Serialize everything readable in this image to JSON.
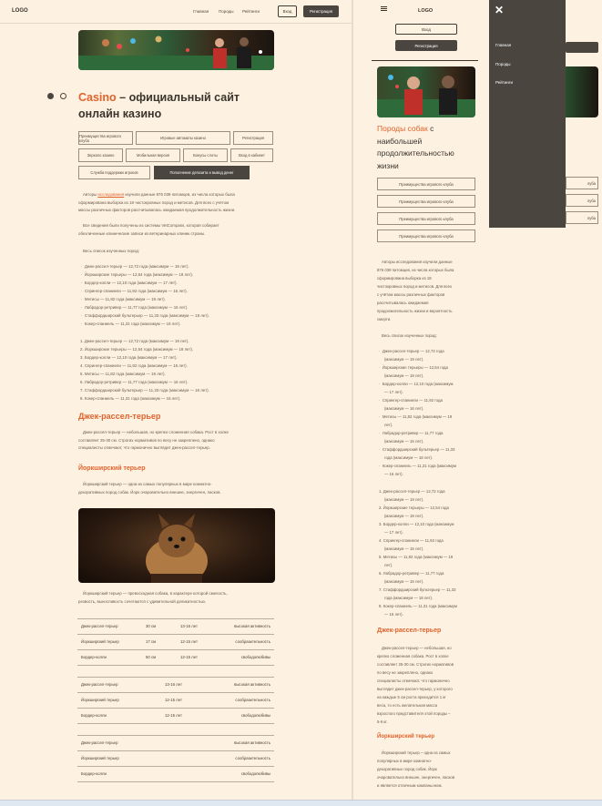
{
  "desktop": {
    "logo": "LOGO",
    "nav": [
      "Главная",
      "Породы",
      "Рейтинги"
    ],
    "login": "Вход",
    "register": "Регистрация",
    "title_highlight": "Casino",
    "title_rest_1": " – официальный сайт",
    "title_rest_2": "онлайн казино",
    "tags": [
      "Преимущества игрового клуба",
      "Игровые автоматы казино",
      "Регистрация",
      "Зеркало казино",
      "Мобильная версия",
      "Бонусы слоты",
      "Вход в кабинет",
      "Служба поддержки игроков",
      "Пополнение депозита и вывод денег"
    ],
    "intro_1a": "Авторы ",
    "intro_link": "исследования",
    "intro_1b": " изучили данные 876 039 питомцев, из числа которых была",
    "intro_2": "сформирована выборка из 18 чистокровных пород и метисов. Для всех с учётом",
    "intro_3": "массы различных факторов рассчитывалась ожидаемая продолжительность жизни.",
    "intro2_1": "Все сведения были получены из системы VetCompass, которая собирает",
    "intro2_2": "обезличенные клинические записи из ветеринарных клиник страны.",
    "list_heading": "Весь список изученных пород:",
    "bullets": [
      "Джек-рассел-терьер — 12,72 года (максимум — 19 лет).",
      "Йоркширские терьеры — 12,54 года (максимум — 18 лет).",
      "Бордер-колли — 12,10 года (максимум — 17 лет).",
      "Спрингер-спаниели — 11,92 года (максимум — 16 лет).",
      "Метисы — 11,82 года (максимум — 19 лет).",
      "Лабрадор-ретривер — 11,77 года (максимум — 16 лет).",
      "Стаффордширский бультерьер — 11,33 года (максимум — 18 лет).",
      "Кокер-спаниель — 11,31 года (максимум — 16 лет)."
    ],
    "numbered": [
      "1. Джек-рассел-терьер — 12,72 года (максимум — 19 лет).",
      "2. Йоркширские терьеры — 12,54 года (максимум — 18 лет).",
      "3. Бордер-колли — 12,10 года (максимум — 17 лет).",
      "4. Спрингер-спаниели — 11,92 года (максимум — 16 лет).",
      "5. Метисы — 11,82 года (максимум — 19 лет).",
      "6. Лабрадор-ретривер — 11,77 года (максимум — 16 лет).",
      "7. Стаффордширский бультерьер — 11,33 года (максимум — 18 лет).",
      "8. Кокер-спаниель — 11,31 года (максимум — 16 лет)."
    ],
    "h2_jack": "Джек-рассел-терьер",
    "jack_1": "Джек-рассел-терьер — небольшая, но крепко сложенная собака. Рост в холке",
    "jack_2": "составляет 25-30 см. Строгих нормативов по весу не закреплено, однако",
    "jack_3": "специалисты отмечают, что гармонично выглядит джек-рассел-терьер.",
    "h3_york": "Йоркширский терьер",
    "york_1": "Йоркширский терьер — одна из самых популярных в мире комнатно-",
    "york_2": "декоративных пород собак. Йорк очаровательно внешне, энергичен, ласков.",
    "york2_1": "Йоркширский терьер — превосходная собака, в характере которой смелость,",
    "york2_2": "резвость, выносливость сочетаются с удивительной деликатностью.",
    "table1": [
      [
        "Джек-рассел-терьер",
        "30 см",
        "13-16 лет",
        "высокая активность"
      ],
      [
        "Йоркширский терьер",
        "17 см",
        "12-15 лет",
        "сообразительность"
      ],
      [
        "Бордер-колли",
        "50 см",
        "12-15 лет",
        "свободолюбивы"
      ]
    ],
    "table2": [
      [
        "Джек-рассел-терьер",
        "13-16 лет",
        "высокая активность"
      ],
      [
        "Йоркширский терьер",
        "12-15 лет",
        "сообразительность"
      ],
      [
        "Бордер-колли",
        "12-15 лет",
        "свободолюбивы"
      ]
    ],
    "table3": [
      [
        "Джек-рассел-терьер",
        "высокая активность"
      ],
      [
        "Йоркширский терьер",
        "сообразительность"
      ],
      [
        "Бордер-колли",
        "свободолюбивы"
      ]
    ]
  },
  "mobile": {
    "logo": "LOGO",
    "login": "Вход",
    "register": "Регистрация",
    "title_1a": "Породы собак",
    "title_1b": " с",
    "title_2": "наибольшей",
    "title_3": "продолжительностью",
    "title_4": "жизни",
    "tags": [
      "Преимущества игрового клуба",
      "Преимущества игрового клуба",
      "Преимущества игрового клуба",
      "Преимущества игрового клуба"
    ],
    "intro": [
      "Авторы исследования изучили данные",
      "876 039 питомцев, из числа которых была",
      "сформирована выборка из 18",
      "чистокровных пород и метисов. Для всех",
      "с учётом массы различных факторов",
      "рассчитывалась ожидаемая",
      "продолжительность жизни и вероятность",
      "смерти."
    ],
    "list_heading": "Весь список изученных пород:",
    "bullets": [
      "Джек-рассел-терьер — 12,72 года",
      "(максимум — 19 лет).",
      "Йоркширские терьеры — 12,54 года",
      "(максимум — 18 лет).",
      "Бордер-колли — 12,10 года (максимум",
      "— 17 лет).",
      "Спрингер-спаниели — 11,92 года",
      "(максимум — 16 лет).",
      "Метисы — 11,82 года (максимум — 19",
      "лет).",
      "Лабрадор-ретривер — 11,77 года",
      "(максимум — 16 лет).",
      "Стаффордширский бультерьер — 11,33",
      "года (максимум — 18 лет).",
      "Кокер-спаниель — 11,31 года (максимум",
      "— 16 лет)."
    ],
    "numbered": [
      "1. Джек-рассел-терьер — 12,72 года",
      "(максимум — 19 лет).",
      "2. Йоркширские терьеры — 12,54 года",
      "(максимум — 18 лет).",
      "3. Бордер-колли — 12,10 года (максимум",
      "— 17 лет).",
      "4. Спрингер-спаниели — 11,92 года",
      "(максимум — 16 лет).",
      "5. Метисы — 11,82 года (максимум — 19",
      "лет).",
      "6. Лабрадор-ретривер — 11,77 года",
      "(максимум — 16 лет).",
      "7. Стаффордширский бультерьер — 11,33",
      "года (максимум — 18 лет).",
      "8. Кокер-спаниель — 11,31 года (максимум",
      "— 16 лет)."
    ],
    "h2_jack": "Джек-рассел-терьер",
    "jack": [
      "Джек-рассел-терьер — небольшая, но",
      "крепко сложенная собака. Рост в холке",
      "составляет 25-30 см. Строгих нормативов",
      "по весу не закреплено, однако",
      "специалисты отмечают, что гармонично",
      "выглядит джек-рассел-терьер, у которого",
      "на каждые 5 см роста приходится 1 кг",
      "веса, то есть желательная масса",
      "взрослого представителя этой породы –",
      "5-6 кг."
    ],
    "h3_york": "Йоркширский терьер",
    "york": [
      "Йоркширский терьер – одна из самых",
      "популярных в мире комнатно-",
      "декоративных пород собак. Йорк",
      "очаровательно внешне, энергичен, ласков",
      "и является отличным компаньоном."
    ]
  },
  "drawer": {
    "items": [
      "Главная",
      "Породы",
      "Рейтинги"
    ]
  },
  "colors": {
    "accent": "#e1632d",
    "dark": "#4a463f",
    "bg": "#fdf1e1"
  }
}
